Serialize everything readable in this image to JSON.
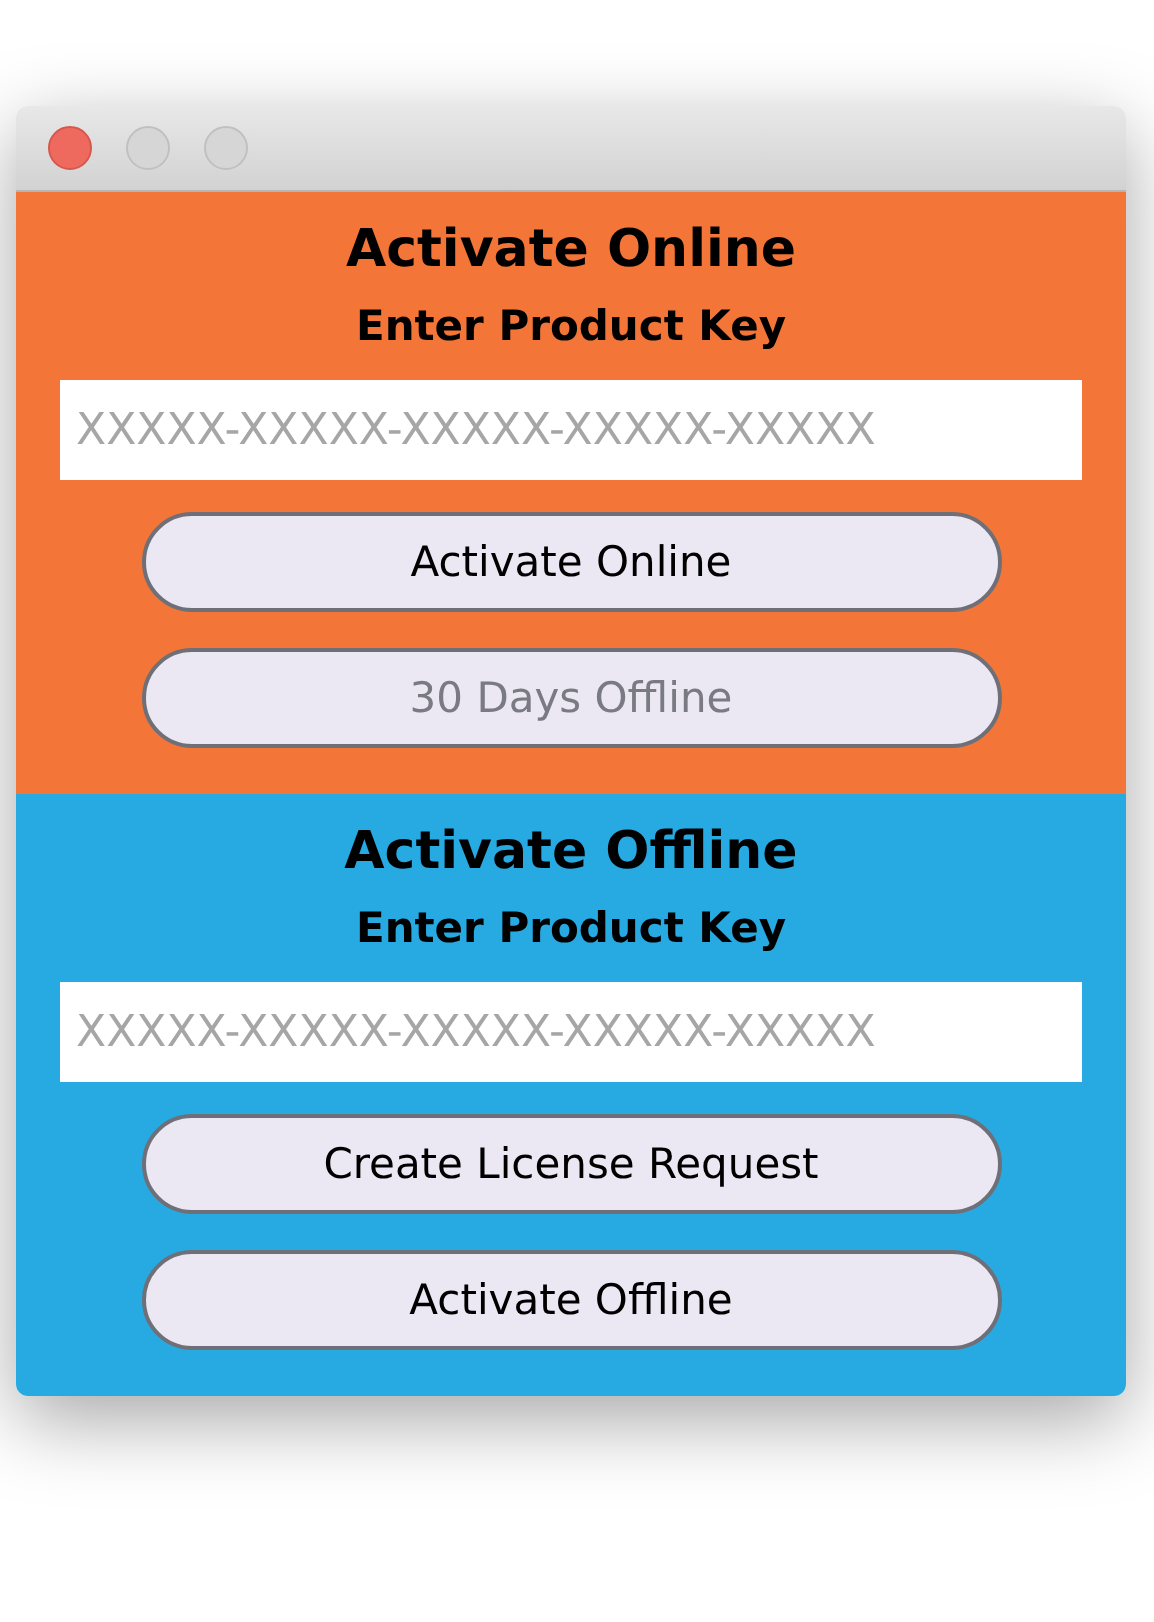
{
  "sections": [
    {
      "title": "Activate Online",
      "subtitle": "Enter Product Key",
      "color": "#f37638",
      "key_field": {
        "placeholder": "XXXXX-XXXXX-XXXXX-XXXXX-XXXXX"
      },
      "buttons": [
        {
          "label": "Activate Online",
          "disabled": false
        },
        {
          "label": "30 Days Offline",
          "disabled": true
        }
      ]
    },
    {
      "title": "Activate Offline",
      "subtitle": "Enter Product Key",
      "color": "#27a9e1",
      "key_field": {
        "placeholder": "XXXXX-XXXXX-XXXXX-XXXXX-XXXXX"
      },
      "buttons": [
        {
          "label": "Create License Request",
          "disabled": false
        },
        {
          "label": "Activate Offline",
          "disabled": false
        }
      ]
    }
  ]
}
